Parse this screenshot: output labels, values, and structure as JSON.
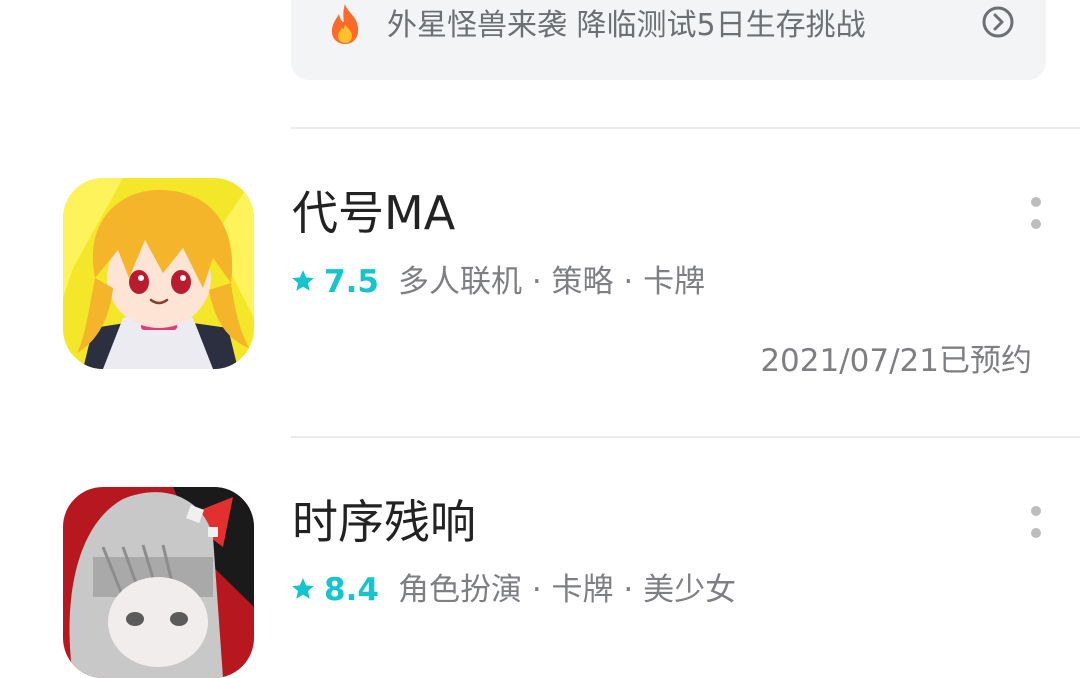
{
  "banner": {
    "icon": "fire-icon",
    "text": "外星怪兽来袭 降临测试5日生存挑战",
    "arrow_icon": "chevron-right-circle-icon"
  },
  "games": [
    {
      "title": "代号MA",
      "rating": "7.5",
      "tags": "多人联机 · 策略 · 卡牌",
      "status": "2021/07/21已预约",
      "icon": "anime-girl-game-icon"
    },
    {
      "title": "时序残响",
      "rating": "8.4",
      "tags": "角色扮演 · 卡牌 · 美少女",
      "icon": "gray-hair-girl-game-icon"
    }
  ],
  "colors": {
    "accent": "#15c5ce",
    "banner_bg": "#f2f4f5",
    "divider": "#ebebeb",
    "secondary_text": "#7d7f82"
  }
}
